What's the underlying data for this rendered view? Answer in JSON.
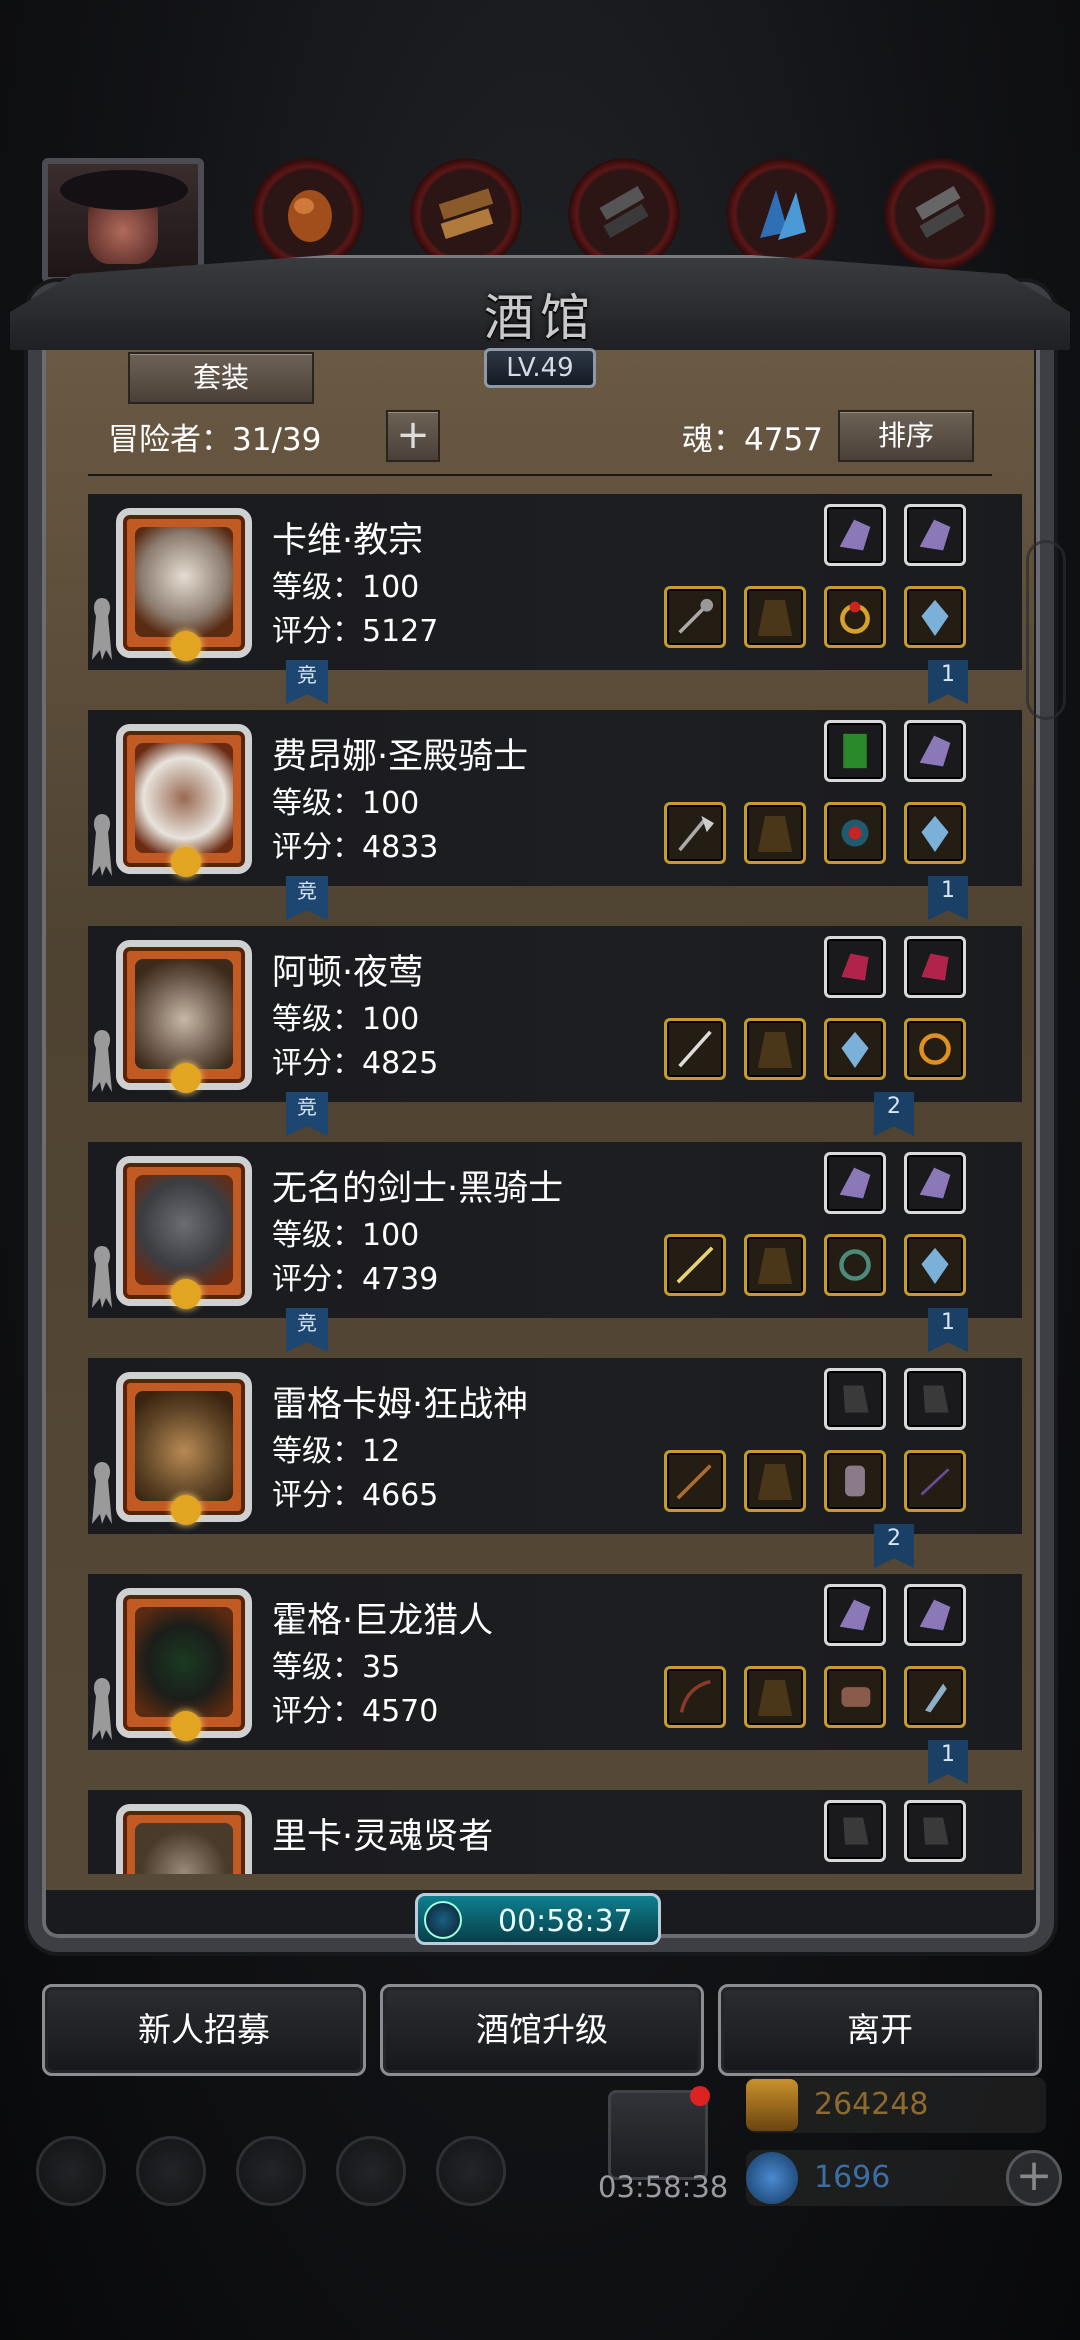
{
  "window": {
    "title": "酒馆",
    "level": "LV.49"
  },
  "toolbar": {
    "set_label": "套装",
    "adventurers": "冒险者：31/39",
    "plus": "+",
    "soul": "魂：4757",
    "sort_label": "排序"
  },
  "heroes": [
    {
      "name": "卡维·教宗",
      "level": "等级：100",
      "score": "评分：5127",
      "tag_left": "竞",
      "tag_right": "1"
    },
    {
      "name": "费昂娜·圣殿骑士",
      "level": "等级：100",
      "score": "评分：4833",
      "tag_left": "竞",
      "tag_right": "1"
    },
    {
      "name": "阿顿·夜莺",
      "level": "等级：100",
      "score": "评分：4825",
      "tag_left": "竞",
      "tag_right": "2"
    },
    {
      "name": "无名的剑士·黑骑士",
      "level": "等级：100",
      "score": "评分：4739",
      "tag_left": "竞",
      "tag_right": "1"
    },
    {
      "name": "雷格卡姆·狂战神",
      "level": "等级：12",
      "score": "评分：4665",
      "tag_left": "",
      "tag_right": "2"
    },
    {
      "name": "霍格·巨龙猎人",
      "level": "等级：35",
      "score": "评分：4570",
      "tag_left": "",
      "tag_right": "1"
    },
    {
      "name": "里卡·灵魂贤者",
      "level": "",
      "score": "",
      "tag_left": "",
      "tag_right": ""
    }
  ],
  "timer": "00:58:37",
  "actions": {
    "recruit": "新人招募",
    "upgrade": "酒馆升级",
    "leave": "离开"
  },
  "footer": {
    "gift_timer": "03:58:38",
    "gold": "264248",
    "gems": "1696",
    "add": "+"
  },
  "colors": {
    "accent_gold": "#c79b2a",
    "portrait_orange": "#c25a23",
    "timer_teal": "#0e7f8e"
  }
}
